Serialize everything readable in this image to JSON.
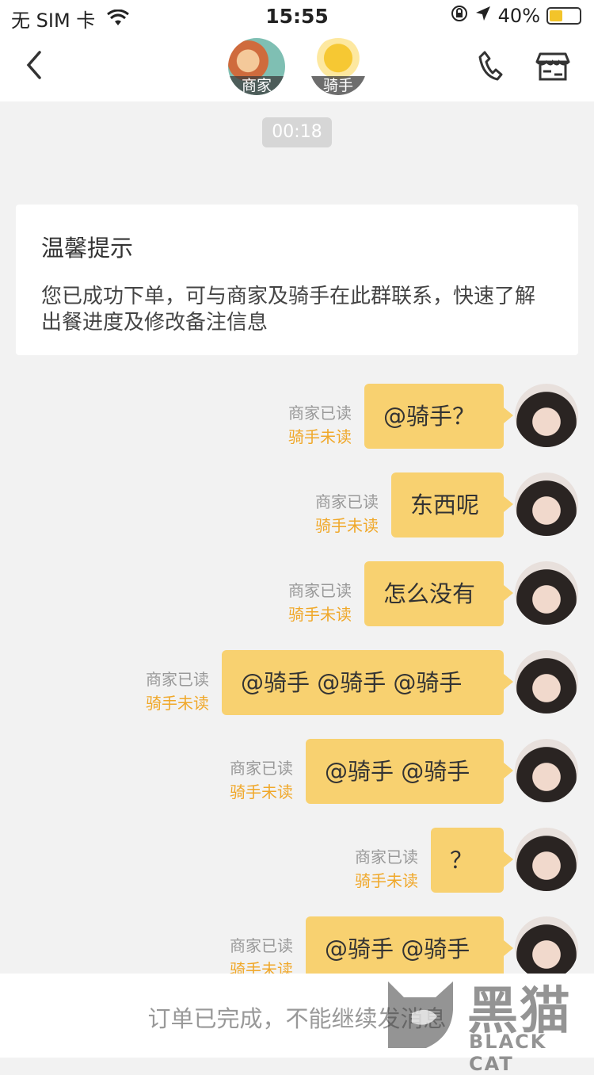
{
  "status_bar": {
    "carrier": "无 SIM 卡",
    "time": "15:55",
    "battery": "40%"
  },
  "header": {
    "merchant_label": "商家",
    "rider_label": "骑手"
  },
  "chat": {
    "time_label": "00:18",
    "tip": {
      "title": "温馨提示",
      "body": "您已成功下单，可与商家及骑手在此群联系，快速了解出餐进度及修改备注信息"
    },
    "messages": [
      {
        "text": "@骑手？",
        "merchant_status": "商家已读",
        "rider_status": "骑手未读"
      },
      {
        "text": "东西呢",
        "merchant_status": "商家已读",
        "rider_status": "骑手未读"
      },
      {
        "text": "怎么没有",
        "merchant_status": "商家已读",
        "rider_status": "骑手未读"
      },
      {
        "text": "@骑手 @骑手 @骑手",
        "merchant_status": "商家已读",
        "rider_status": "骑手未读"
      },
      {
        "text": "@骑手 @骑手",
        "merchant_status": "商家已读",
        "rider_status": "骑手未读"
      },
      {
        "text": "？",
        "merchant_status": "商家已读",
        "rider_status": "骑手未读"
      },
      {
        "text": "@骑手 @骑手",
        "merchant_status": "商家已读",
        "rider_status": "骑手未读"
      }
    ]
  },
  "footer": {
    "notice": "订单已完成，不能继续发消息"
  },
  "watermark": {
    "zh": "黑猫",
    "en": "BLACK CAT"
  },
  "colors": {
    "bubble": "#f8d170",
    "unread": "#f0a82a"
  }
}
